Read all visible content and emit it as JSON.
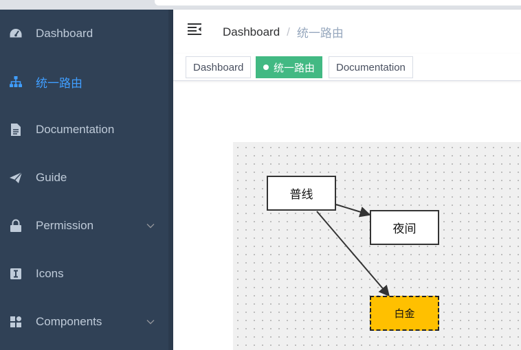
{
  "sidebar": {
    "items": [
      {
        "label": "Dashboard",
        "icon": "dashboard-icon",
        "active": false,
        "has_submenu": false
      },
      {
        "label": "统一路由",
        "icon": "tree-icon",
        "active": true,
        "has_submenu": false
      },
      {
        "label": "Documentation",
        "icon": "documentation-icon",
        "active": false,
        "has_submenu": false
      },
      {
        "label": "Guide",
        "icon": "guide-icon",
        "active": false,
        "has_submenu": false
      },
      {
        "label": "Permission",
        "icon": "lock-icon",
        "active": false,
        "has_submenu": true
      },
      {
        "label": "Icons",
        "icon": "icons-icon",
        "active": false,
        "has_submenu": false
      },
      {
        "label": "Components",
        "icon": "component-icon",
        "active": false,
        "has_submenu": true
      }
    ],
    "text_color": "#bfcbd9",
    "active_color": "#409eff",
    "bg_color": "#304156"
  },
  "navbar": {
    "breadcrumb": {
      "home": "Dashboard",
      "separator": "/",
      "current": "统一路由"
    }
  },
  "tags": [
    {
      "label": "Dashboard",
      "active": false
    },
    {
      "label": "统一路由",
      "active": true
    },
    {
      "label": "Documentation",
      "active": false
    }
  ],
  "flow": {
    "nodes": [
      {
        "id": "n1",
        "label": "普线",
        "style": "solid"
      },
      {
        "id": "n2",
        "label": "夜间",
        "style": "solid"
      },
      {
        "id": "n3",
        "label": "白金",
        "style": "dashed",
        "fill": "#ffc000"
      }
    ],
    "edges": [
      {
        "from": "普线",
        "to": "夜间"
      },
      {
        "from": "普线",
        "to": "白金"
      }
    ]
  }
}
